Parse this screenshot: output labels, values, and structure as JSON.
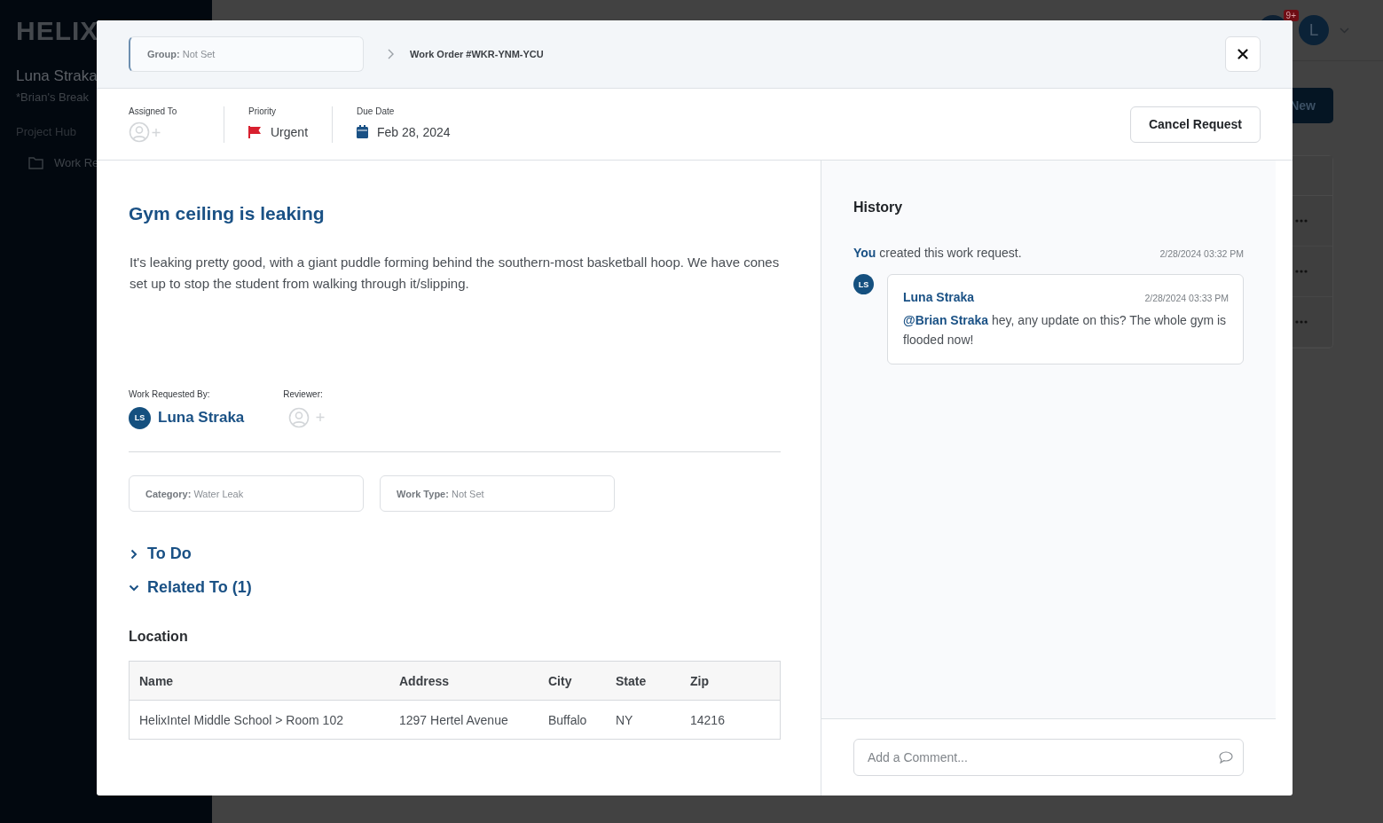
{
  "background": {
    "logo": "HELIX",
    "user_name": "Luna Straka",
    "project": "*Brian's Break",
    "nav_section": "Project Hub",
    "nav_items": [
      {
        "label": "Work Re"
      }
    ],
    "notification_badge": "9+",
    "avatar_initial": "L",
    "new_button": "New"
  },
  "modal": {
    "group_field": {
      "label": "Group:",
      "value": "Not Set"
    },
    "breadcrumb": "Work Order #WKR-YNM-YCU",
    "assigned_to": {
      "label": "Assigned To"
    },
    "priority": {
      "label": "Priority",
      "value": "Urgent"
    },
    "due_date": {
      "label": "Due Date",
      "value": "Feb 28, 2024"
    },
    "cancel_button": "Cancel Request",
    "title": "Gym ceiling is leaking",
    "description": "It's leaking pretty good, with a giant puddle forming behind the southern-most basketball hoop. We have cones set up to stop the student from walking through it/slipping.",
    "requested_by": {
      "label": "Work Requested By:",
      "initials": "LS",
      "name": "Luna Straka"
    },
    "reviewer": {
      "label": "Reviewer:"
    },
    "fields": [
      {
        "label": "Category:",
        "value": "Water Leak"
      },
      {
        "label": "Work Type:",
        "value": "Not Set"
      }
    ],
    "sections": [
      {
        "label": "To Do",
        "expanded": false
      },
      {
        "label": "Related To (1)",
        "expanded": true
      }
    ],
    "location": {
      "title": "Location",
      "columns": [
        "Name",
        "Address",
        "City",
        "State",
        "Zip"
      ],
      "rows": [
        [
          "HelixIntel Middle School > Room 102",
          "1297 Hertel Avenue",
          "Buffalo",
          "NY",
          "14216"
        ]
      ]
    },
    "history": {
      "title": "History",
      "entries": [
        {
          "kind": "event",
          "text": "**You** created this work request.",
          "time": "2/28/2024 03:32 PM"
        },
        {
          "kind": "comment",
          "initials": "LS",
          "author": "Luna Straka",
          "time": "2/28/2024 03:33 PM",
          "text": "**@Brian Straka** hey, any update on this? The whole gym is flooded now!"
        }
      ]
    },
    "comment_placeholder": "Add a Comment..."
  }
}
